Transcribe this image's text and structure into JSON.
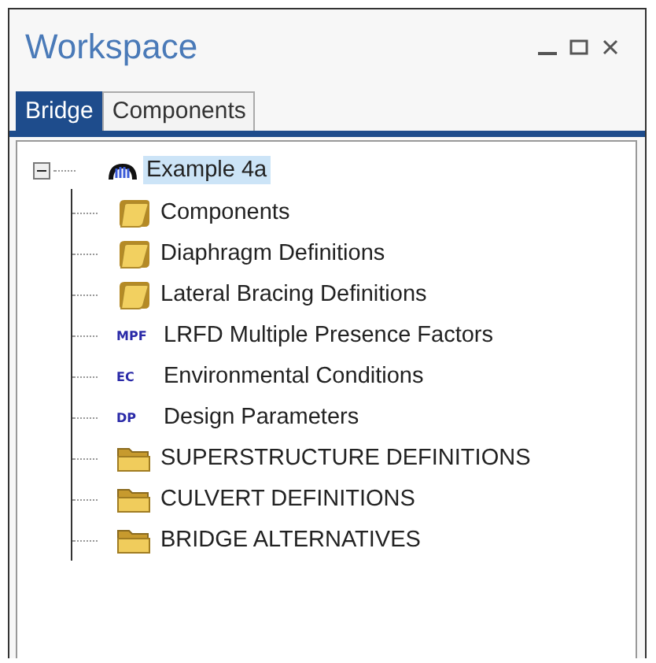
{
  "window": {
    "title": "Workspace"
  },
  "tabs": [
    {
      "label": "Bridge",
      "selected": true
    },
    {
      "label": "Components",
      "selected": false
    }
  ],
  "tree": {
    "label": "Example 4a",
    "expanded": true,
    "selected": true,
    "children": [
      {
        "kind": "folder",
        "label": "Components"
      },
      {
        "kind": "folder",
        "label": "Diaphragm Definitions"
      },
      {
        "kind": "folder",
        "label": "Lateral Bracing Definitions"
      },
      {
        "kind": "code",
        "code": "MPF",
        "label": "LRFD Multiple Presence Factors"
      },
      {
        "kind": "code",
        "code": "EC",
        "label": "Environmental Conditions"
      },
      {
        "kind": "code",
        "code": "DP",
        "label": "Design Parameters"
      },
      {
        "kind": "open-folder",
        "label": "SUPERSTRUCTURE DEFINITIONS"
      },
      {
        "kind": "open-folder",
        "label": "CULVERT DEFINITIONS"
      },
      {
        "kind": "open-folder",
        "label": "BRIDGE ALTERNATIVES"
      }
    ]
  }
}
